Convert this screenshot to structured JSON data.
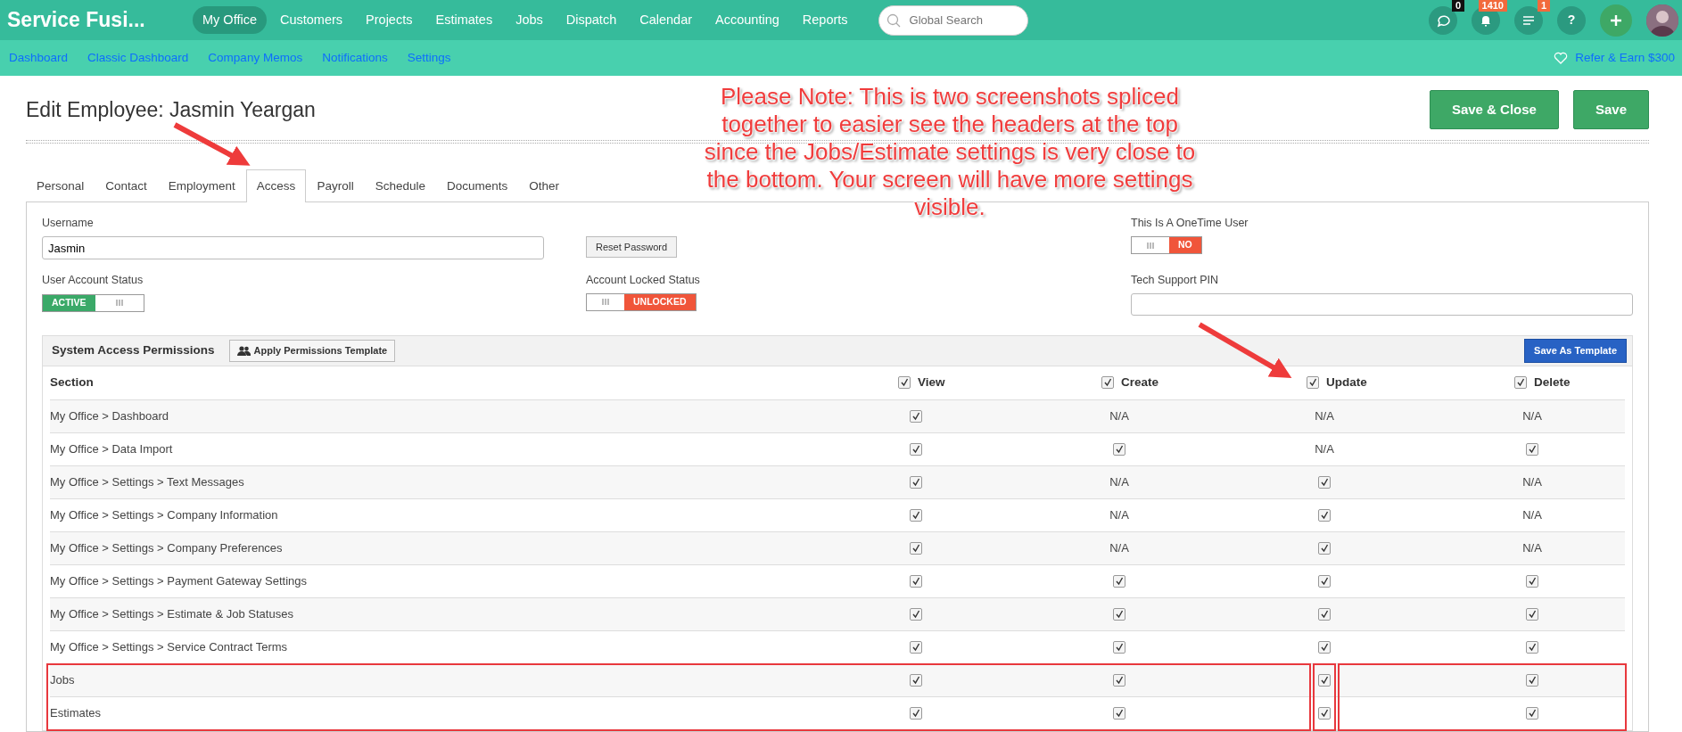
{
  "app": {
    "brand": "Service Fusi...",
    "nav": [
      {
        "label": "My Office",
        "selected": true
      },
      {
        "label": "Customers",
        "selected": false
      },
      {
        "label": "Projects",
        "selected": false
      },
      {
        "label": "Estimates",
        "selected": false
      },
      {
        "label": "Jobs",
        "selected": false
      },
      {
        "label": "Dispatch",
        "selected": false
      },
      {
        "label": "Calendar",
        "selected": false
      },
      {
        "label": "Accounting",
        "selected": false
      },
      {
        "label": "Reports",
        "selected": false
      }
    ],
    "search": {
      "placeholder": "Global Search"
    },
    "tools": [
      {
        "kind": "chat",
        "badge": {
          "text": "0",
          "color": "#111111"
        }
      },
      {
        "kind": "bell",
        "badge": {
          "text": "1410",
          "color": "#f26a3c"
        }
      },
      {
        "kind": "tasks",
        "badge": {
          "text": "1",
          "color": "#f26a3c"
        }
      },
      {
        "kind": "help",
        "label": "?"
      },
      {
        "kind": "add"
      },
      {
        "kind": "avatar"
      }
    ],
    "subnav": [
      "Dashboard",
      "Classic Dashboard",
      "Company Memos",
      "Notifications",
      "Settings"
    ],
    "refer": "Refer & Earn $300"
  },
  "page": {
    "title": "Edit Employee: Jasmin Yeargan",
    "buttons": [
      "Save & Close",
      "Save"
    ],
    "tabs": [
      {
        "label": "Personal",
        "selected": false
      },
      {
        "label": "Contact",
        "selected": false
      },
      {
        "label": "Employment",
        "selected": false
      },
      {
        "label": "Access",
        "selected": true
      },
      {
        "label": "Payroll",
        "selected": false
      },
      {
        "label": "Schedule",
        "selected": false
      },
      {
        "label": "Documents",
        "selected": false
      },
      {
        "label": "Other",
        "selected": false
      }
    ]
  },
  "form": {
    "username": {
      "label": "Username",
      "value": "Jasmin"
    },
    "reset_button": "Reset Password",
    "onetime": {
      "label": "This Is A OneTime User",
      "toggle": {
        "on": false,
        "text": "NO"
      }
    },
    "account_status": {
      "label": "User Account Status",
      "toggle": {
        "on": true,
        "text": "ACTIVE"
      }
    },
    "locked_status": {
      "label": "Account Locked Status",
      "toggle": {
        "on": false,
        "text": "UNLOCKED"
      }
    },
    "pin": {
      "label": "Tech Support PIN"
    }
  },
  "permissions": {
    "title": "System Access Permissions",
    "apply_button": "Apply Permissions Template",
    "save_button": "Save As Template",
    "columns": [
      {
        "label": "Section"
      },
      {
        "label": "View",
        "checked": true
      },
      {
        "label": "Create",
        "checked": true
      },
      {
        "label": "Update",
        "checked": true
      },
      {
        "label": "Delete",
        "checked": true
      }
    ],
    "rows": [
      {
        "section": "My Office > Dashboard",
        "highlighted": false,
        "cells": [
          {
            "kind": "check",
            "checked": true
          },
          {
            "kind": "text",
            "text": "N/A"
          },
          {
            "kind": "text",
            "text": "N/A"
          },
          {
            "kind": "text",
            "text": "N/A"
          }
        ]
      },
      {
        "section": "My Office > Data Import",
        "highlighted": false,
        "cells": [
          {
            "kind": "check",
            "checked": true
          },
          {
            "kind": "check",
            "checked": true
          },
          {
            "kind": "text",
            "text": "N/A"
          },
          {
            "kind": "check",
            "checked": true
          }
        ]
      },
      {
        "section": "My Office > Settings > Text Messages",
        "highlighted": false,
        "cells": [
          {
            "kind": "check",
            "checked": true
          },
          {
            "kind": "text",
            "text": "N/A"
          },
          {
            "kind": "check",
            "checked": true
          },
          {
            "kind": "text",
            "text": "N/A"
          }
        ]
      },
      {
        "section": "My Office > Settings > Company Information",
        "highlighted": false,
        "cells": [
          {
            "kind": "check",
            "checked": true
          },
          {
            "kind": "text",
            "text": "N/A"
          },
          {
            "kind": "check",
            "checked": true
          },
          {
            "kind": "text",
            "text": "N/A"
          }
        ]
      },
      {
        "section": "My Office > Settings > Company Preferences",
        "highlighted": false,
        "cells": [
          {
            "kind": "check",
            "checked": true
          },
          {
            "kind": "text",
            "text": "N/A"
          },
          {
            "kind": "check",
            "checked": true
          },
          {
            "kind": "text",
            "text": "N/A"
          }
        ]
      },
      {
        "section": "My Office > Settings > Payment Gateway Settings",
        "highlighted": false,
        "cells": [
          {
            "kind": "check",
            "checked": true
          },
          {
            "kind": "check",
            "checked": true
          },
          {
            "kind": "check",
            "checked": true
          },
          {
            "kind": "check",
            "checked": true
          }
        ]
      },
      {
        "section": "My Office > Settings > Estimate & Job Statuses",
        "highlighted": false,
        "cells": [
          {
            "kind": "check",
            "checked": true
          },
          {
            "kind": "check",
            "checked": true
          },
          {
            "kind": "check",
            "checked": true
          },
          {
            "kind": "check",
            "checked": true
          }
        ]
      },
      {
        "section": "My Office > Settings > Service Contract Terms",
        "highlighted": false,
        "cells": [
          {
            "kind": "check",
            "checked": true
          },
          {
            "kind": "check",
            "checked": true
          },
          {
            "kind": "check",
            "checked": true
          },
          {
            "kind": "check",
            "checked": true
          }
        ]
      },
      {
        "section": "Jobs",
        "highlighted": true,
        "cells": [
          {
            "kind": "check",
            "checked": true
          },
          {
            "kind": "check",
            "checked": true
          },
          {
            "kind": "check",
            "checked": true
          },
          {
            "kind": "check",
            "checked": true
          }
        ]
      },
      {
        "section": "Estimates",
        "highlighted": true,
        "cells": [
          {
            "kind": "check",
            "checked": true
          },
          {
            "kind": "check",
            "checked": true
          },
          {
            "kind": "check",
            "checked": true
          },
          {
            "kind": "check",
            "checked": true
          }
        ]
      }
    ]
  },
  "annotation": {
    "note": "Please Note: This is two screenshots spliced together to easier see the headers at the top since the Jobs/Estimate settings is very close to the bottom. Your screen will have more settings visible."
  }
}
